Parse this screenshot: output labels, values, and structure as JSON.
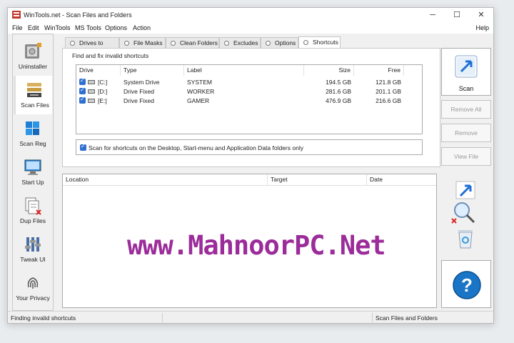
{
  "window": {
    "title": "WinTools.net - Scan Files and Folders",
    "controls": {
      "minimize": "─",
      "maximize": "☐",
      "close": "✕"
    }
  },
  "menu": [
    "File",
    "Edit",
    "WinTools",
    "MS Tools",
    "Options",
    "Action"
  ],
  "menu_help": "Help",
  "sidebar": [
    {
      "label": "Uninstaller",
      "icon": "uninstaller-icon"
    },
    {
      "label": "Scan Files",
      "icon": "scan-files-icon",
      "active": true
    },
    {
      "label": "Scan Reg",
      "icon": "scan-reg-icon"
    },
    {
      "label": "Start Up",
      "icon": "start-up-icon"
    },
    {
      "label": "Dup Files",
      "icon": "dup-files-icon"
    },
    {
      "label": "Tweak UI",
      "icon": "tweak-ui-icon"
    },
    {
      "label": "Your Privacy",
      "icon": "fingerprint-icon"
    }
  ],
  "tabs": [
    "Drives to Scan",
    "File Masks",
    "Clean Folders",
    "Excludes",
    "Options",
    "Shortcuts"
  ],
  "active_tab": "Shortcuts",
  "group_title": "Find and fix invalid shortcuts",
  "drive_table": {
    "columns": [
      "Drive",
      "Type",
      "Label",
      "Size",
      "Free"
    ],
    "rows": [
      {
        "drive": "[C:]",
        "type": "System Drive",
        "label": "SYSTEM",
        "size": "194.5 GB",
        "free": "121.8 GB",
        "checked": true
      },
      {
        "drive": "[D:]",
        "type": "Drive Fixed",
        "label": "WORKER",
        "size": "281.6 GB",
        "free": "201.1 GB",
        "checked": true
      },
      {
        "drive": "[E:]",
        "type": "Drive Fixed",
        "label": "GAMER",
        "size": "476.9 GB",
        "free": "216.6 GB",
        "checked": true
      }
    ]
  },
  "option_label": "Scan for shortcuts on the Desktop, Start-menu and Application Data folders only",
  "results_table": {
    "columns": [
      "Location",
      "Target",
      "Date"
    ]
  },
  "buttons": {
    "scan": "Scan",
    "remove_all": "Remove All",
    "remove": "Remove",
    "view_file": "View File",
    "help": "?"
  },
  "status": {
    "left": "Finding invalid shortcuts",
    "right": "Scan Files and Folders"
  },
  "watermark": "www.MahnoorPC.Net",
  "colors": {
    "accent": "#2f6fd1",
    "watermark": "#9b2c9a",
    "help": "#1a75c6"
  }
}
